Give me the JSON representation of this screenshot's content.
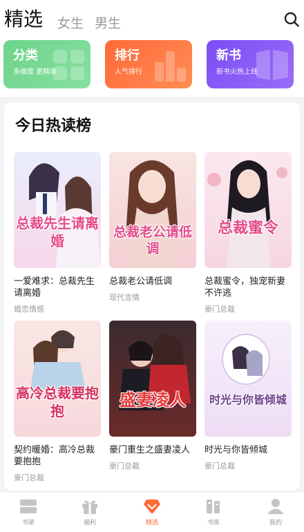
{
  "header": {
    "tabs": [
      {
        "label": "精选",
        "active": true
      },
      {
        "label": "女生",
        "active": false
      },
      {
        "label": "男生",
        "active": false
      }
    ],
    "search_icon": "search-icon"
  },
  "categories": [
    {
      "title": "分类",
      "subtitle": "多维度 更精准",
      "color": "#6ed48b",
      "icon": "grid-icon"
    },
    {
      "title": "排行",
      "subtitle": "人气排行",
      "color": "#ff6a39",
      "icon": "bar-chart-icon"
    },
    {
      "title": "新书",
      "subtitle": "新书火热上线",
      "color": "#7b4df5",
      "icon": "book-icon"
    }
  ],
  "hot_list": {
    "title": "今日热读榜",
    "books": [
      {
        "name": "一爱难求：总裁先生请离婚",
        "tag": "婚恋情感",
        "cover_text": "总裁先生请离婚"
      },
      {
        "name": "总裁老公请低调",
        "tag": "现代言情",
        "cover_text": "总裁老公请低调"
      },
      {
        "name": "总裁蜜令，独宠新妻不许逃",
        "tag": "豪门总裁",
        "cover_text": "总裁蜜令"
      },
      {
        "name": "契约暖婚：高冷总裁要抱抱",
        "tag": "豪门总裁",
        "cover_text": "高冷总裁要抱抱"
      },
      {
        "name": "豪门重生之盛妻凌人",
        "tag": "豪门总裁",
        "cover_text": "盛妻凌人"
      },
      {
        "name": "时光与你皆倾城",
        "tag": "豪门总裁",
        "cover_text": "时光与你皆倾城"
      }
    ]
  },
  "bottom_nav": [
    {
      "label": "书架",
      "icon": "bookshelf-icon",
      "active": false
    },
    {
      "label": "福利",
      "icon": "gift-icon",
      "active": false
    },
    {
      "label": "精选",
      "icon": "diamond-icon",
      "active": true
    },
    {
      "label": "书库",
      "icon": "library-icon",
      "active": false
    },
    {
      "label": "我的",
      "icon": "profile-icon",
      "active": false
    }
  ],
  "colors": {
    "accent": "#ff6a39",
    "tab_inactive": "#9a9a9a",
    "tag": "#999999"
  }
}
